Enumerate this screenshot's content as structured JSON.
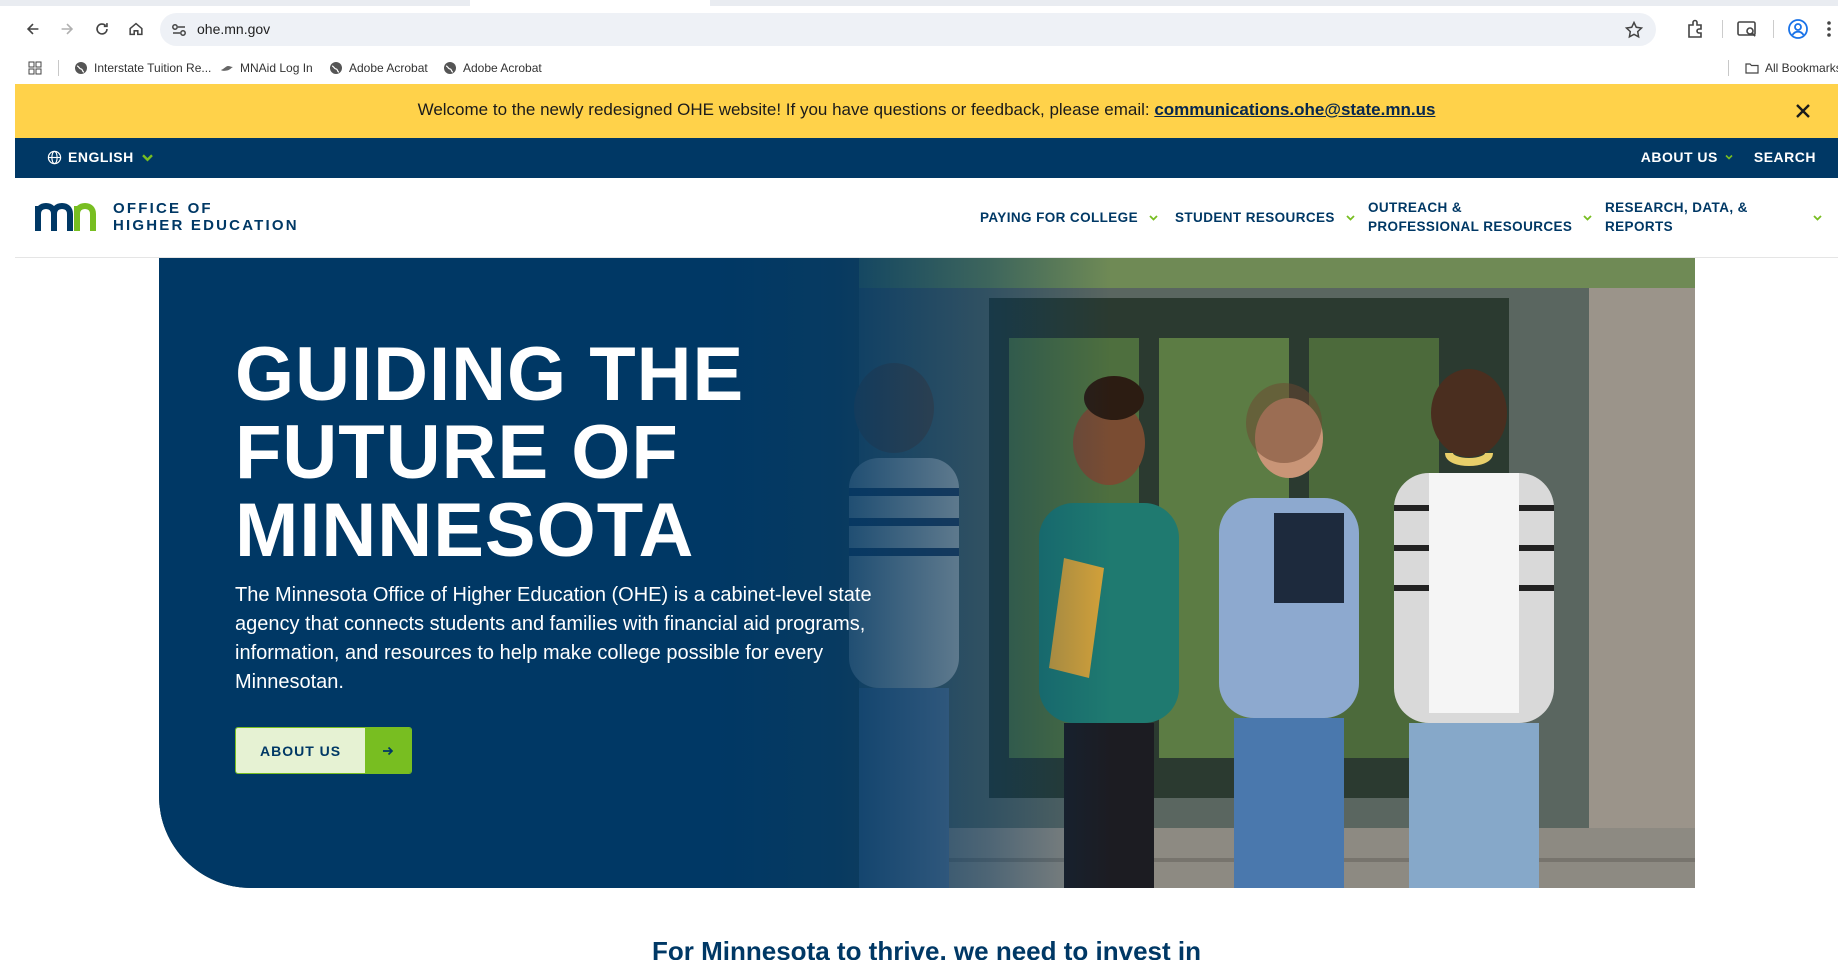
{
  "browser": {
    "url": "ohe.mn.gov",
    "bookmarks": [
      "Interstate Tuition Re...",
      "MNAid Log In",
      "Adobe Acrobat",
      "Adobe Acrobat"
    ],
    "all_bookmarks": "All Bookmarks"
  },
  "alert": {
    "text": "Welcome to the newly redesigned OHE website! If you have questions or feedback, please email: ",
    "email": "communications.ohe@state.mn.us"
  },
  "utility": {
    "language": "ENGLISH",
    "about": "ABOUT US",
    "search": "SEARCH"
  },
  "logo": {
    "line1": "OFFICE OF",
    "line2": "HIGHER EDUCATION"
  },
  "nav": {
    "paying": "PAYING FOR COLLEGE",
    "student": "STUDENT RESOURCES",
    "outreach_1": "OUTREACH &",
    "outreach_2": "PROFESSIONAL RESOURCES",
    "research_1": "RESEARCH, DATA, &",
    "research_2": "REPORTS"
  },
  "hero": {
    "title_1": "GUIDING THE",
    "title_2": "FUTURE OF",
    "title_3": "MINNESOTA",
    "description": "The Minnesota Office of Higher Education (OHE) is a cabinet-level state agency that connects students and families with financial aid programs, information, and resources to help make college possible for every Minnesotan.",
    "button": "ABOUT US"
  },
  "intro": "For Minnesota to thrive, we need to invest in",
  "colors": {
    "navy": "#003865",
    "green": "#78be21",
    "alert": "#ffd24a"
  }
}
